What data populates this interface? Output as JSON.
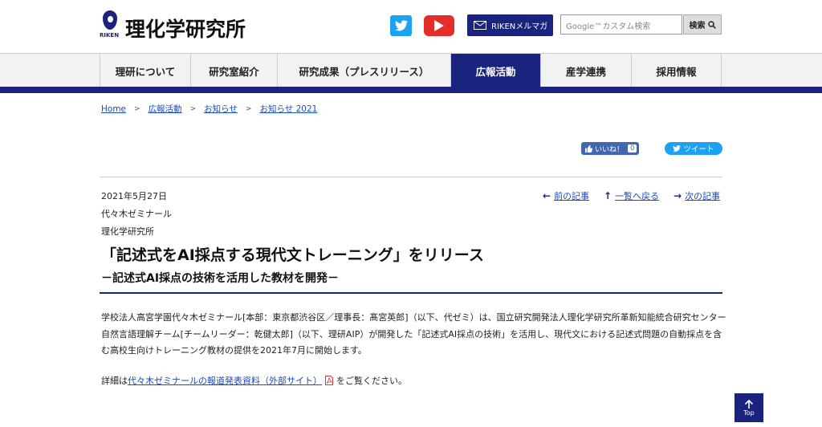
{
  "header": {
    "logo_sub": "RIKEN",
    "logo_text": "理化学研究所",
    "mail_label": "RIKENメルマガ",
    "search_placeholder": "Google™カスタム検索",
    "search_button": "検索"
  },
  "nav": {
    "items": [
      {
        "label": "理研について"
      },
      {
        "label": "研究室紹介"
      },
      {
        "label": "研究成果（プレスリリース）"
      },
      {
        "label": "広報活動"
      },
      {
        "label": "産学連携"
      },
      {
        "label": "採用情報"
      }
    ],
    "active_index": 3
  },
  "breadcrumb": [
    "Home",
    "広報活動",
    "お知らせ",
    "お知らせ 2021"
  ],
  "social": {
    "like_label": "いいね！",
    "like_count": "0",
    "tweet_label": "ツイート"
  },
  "article": {
    "date": "2021年5月27日",
    "org1": "代々木ゼミナール",
    "org2": "理化学研究所",
    "nav_prev": "前の記事",
    "nav_list": "一覧へ戻る",
    "nav_next": "次の記事",
    "title": "「記述式をAI採点する現代文トレーニング」をリリース",
    "subtitle": "－記述式AI採点の技術を活用した教材を開発－",
    "body": "学校法人高宮学園代々木ゼミナール[本部：東京都渋谷区／理事長：髙宮英郎]（以下、代ゼミ）は、国立研究開発法人理化学研究所革新知能統合研究センター自然言語理解チーム[チームリーダー：乾健太郎]（以下、理研AIP）が開発した「記述式AI採点の技術」を活用し、現代文における記述式問題の自動採点を含む高校生向けトレーニング教材の提供を2021年7月に開始します。",
    "detail_prefix": "詳細は",
    "detail_link": "代々木ゼミナールの報道発表資料（外部サイト）",
    "detail_suffix": "をご覧ください。"
  },
  "top_button": "Top",
  "colors": {
    "brand_navy": "#1a237e",
    "link": "#1a4bbf",
    "twitter": "#1da1f2",
    "youtube": "#e52d27",
    "facebook": "#4267b2"
  }
}
